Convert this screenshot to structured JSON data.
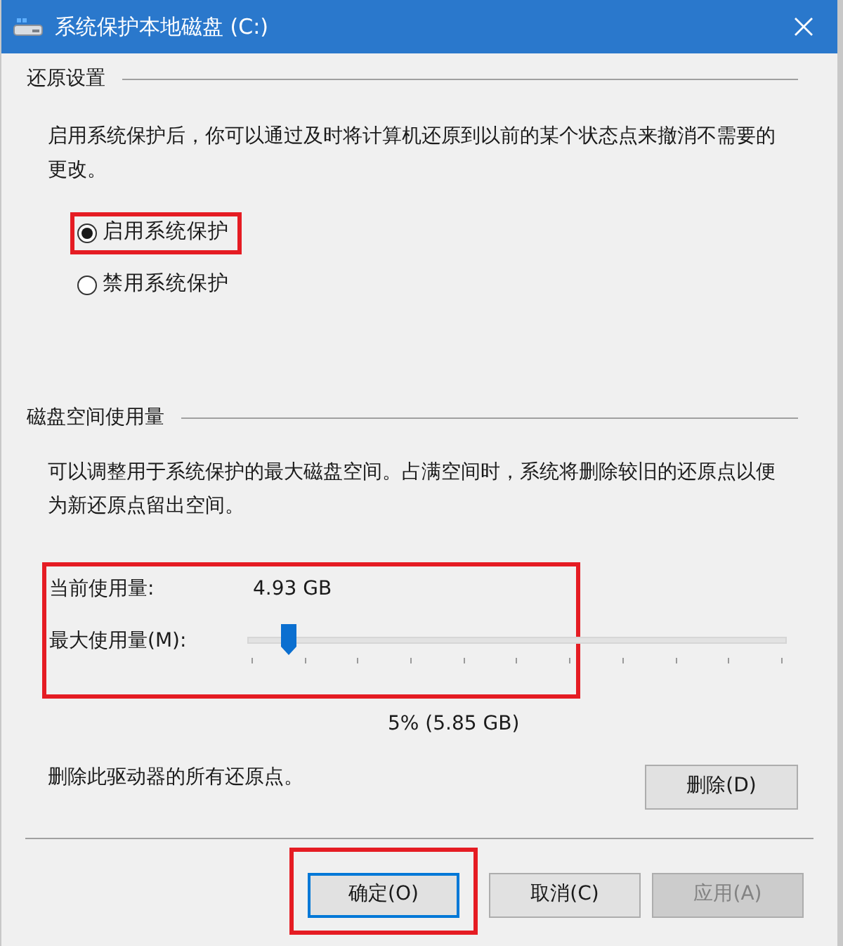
{
  "window": {
    "title": "系统保护本地磁盘 (C:)"
  },
  "restore_settings": {
    "heading": "还原设置",
    "description": "启用系统保护后，你可以通过及时将计算机还原到以前的某个状态点来撤消不需要的更改。",
    "options": [
      {
        "label": "启用系统保护",
        "selected": true
      },
      {
        "label": "禁用系统保护",
        "selected": false
      }
    ]
  },
  "disk_usage": {
    "heading": "磁盘空间使用量",
    "description": "可以调整用于系统保护的最大磁盘空间。占满空间时，系统将删除较旧的还原点以便为新还原点留出空间。",
    "current_usage_label": "当前使用量:",
    "current_usage_value": "4.93 GB",
    "max_usage_label": "最大使用量(M):",
    "slider": {
      "level": 0.05
    },
    "max_usage_reading": "5% (5.85 GB)",
    "delete_text": "删除此驱动器的所有还原点。",
    "delete_button": "删除(D)"
  },
  "buttons": [
    {
      "label": "确定(O)",
      "default": true,
      "disabled": false
    },
    {
      "label": "取消(C)",
      "default": false,
      "disabled": false
    },
    {
      "label": "应用(A)",
      "default": false,
      "disabled": true
    }
  ]
}
